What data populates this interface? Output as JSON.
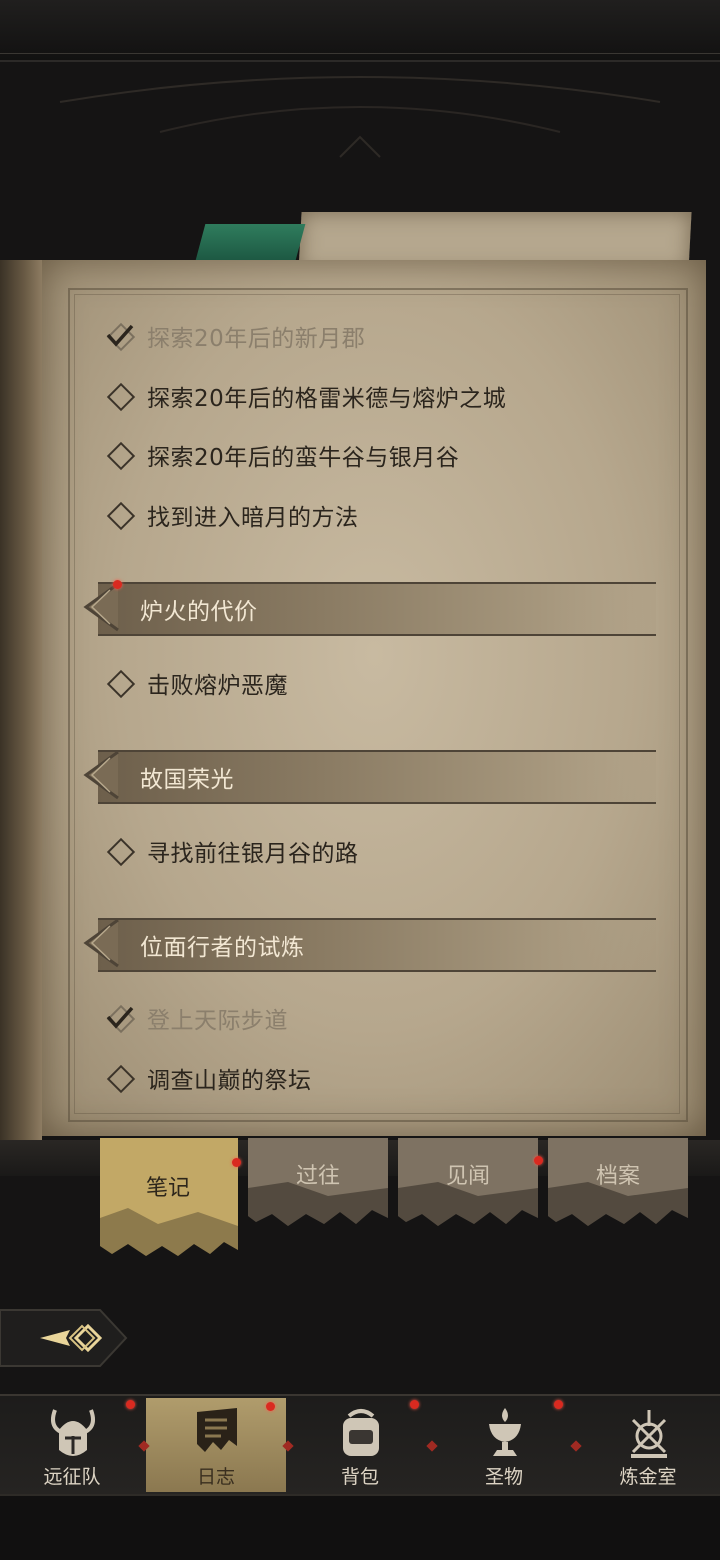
{
  "quest_groups": {
    "main": {
      "items": [
        {
          "text": "探索20年后的新月郡",
          "done": true
        },
        {
          "text": "探索20年后的格雷米德与熔炉之城",
          "done": false
        },
        {
          "text": "探索20年后的蛮牛谷与银月谷",
          "done": false
        },
        {
          "text": "找到进入暗月的方法",
          "done": false
        }
      ]
    },
    "sections": [
      {
        "title": "炉火的代价",
        "has_notification": true,
        "items": [
          {
            "text": "击败熔炉恶魔",
            "done": false
          }
        ]
      },
      {
        "title": "故国荣光",
        "has_notification": false,
        "items": [
          {
            "text": "寻找前往银月谷的路",
            "done": false
          }
        ]
      },
      {
        "title": "位面行者的试炼",
        "has_notification": false,
        "items": [
          {
            "text": "登上天际步道",
            "done": true
          },
          {
            "text": "调查山巅的祭坛",
            "done": false
          }
        ]
      }
    ]
  },
  "tabs": [
    {
      "label": "笔记",
      "active": true,
      "has_notification": true
    },
    {
      "label": "过往",
      "active": false,
      "has_notification": false
    },
    {
      "label": "见闻",
      "active": false,
      "has_notification": true
    },
    {
      "label": "档案",
      "active": false,
      "has_notification": false
    }
  ],
  "bottom_nav": [
    {
      "label": "远征队",
      "icon": "horned-helmet-icon",
      "active": false,
      "has_notification": true
    },
    {
      "label": "日志",
      "icon": "journal-banner-icon",
      "active": true,
      "has_notification": true
    },
    {
      "label": "背包",
      "icon": "backpack-icon",
      "active": false,
      "has_notification": true
    },
    {
      "label": "圣物",
      "icon": "chalice-icon",
      "active": false,
      "has_notification": true
    },
    {
      "label": "炼金室",
      "icon": "alchemy-icon",
      "active": false,
      "has_notification": false
    }
  ],
  "colors": {
    "accent_red": "#d92a20",
    "parchment": "#c8baa1",
    "active_tab": "#c2a866"
  }
}
